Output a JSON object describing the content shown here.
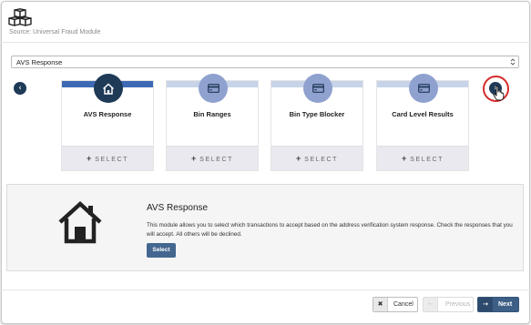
{
  "header": {
    "logo_icon": "cubes-icon",
    "source_text": "Source: Universal Fraud Module"
  },
  "module_select": {
    "value": "AVS Response"
  },
  "carousel": {
    "prev_icon": "chevron-left-icon",
    "next_icon": "chevron-right-icon",
    "cards": [
      {
        "title": "AVS Response",
        "icon": "home-icon",
        "select_label": "SELECT",
        "active": true
      },
      {
        "title": "Bin Ranges",
        "icon": "credit-card-icon",
        "select_label": "SELECT",
        "active": false
      },
      {
        "title": "Bin Type Blocker",
        "icon": "credit-card-icon",
        "select_label": "SELECT",
        "active": false
      },
      {
        "title": "Card Level Results",
        "icon": "credit-card-icon",
        "select_label": "SELECT",
        "active": false
      }
    ]
  },
  "detail": {
    "icon": "house-icon",
    "title": "AVS Response",
    "description": "This module allows you to select which transactions to accept based on the address verification system response. Check the responses that you will accept. All others will be declined.",
    "select_button": "Select"
  },
  "footer": {
    "cancel_label": "Cancel",
    "previous_label": "Previous",
    "next_label": "Next"
  },
  "colors": {
    "accent_dark": "#1f3a57",
    "accent_active_band": "#3e6ab5",
    "inactive_circle": "#8fa1cf",
    "primary_button": "#3d5f86",
    "highlight_ring": "#d62b2b"
  }
}
